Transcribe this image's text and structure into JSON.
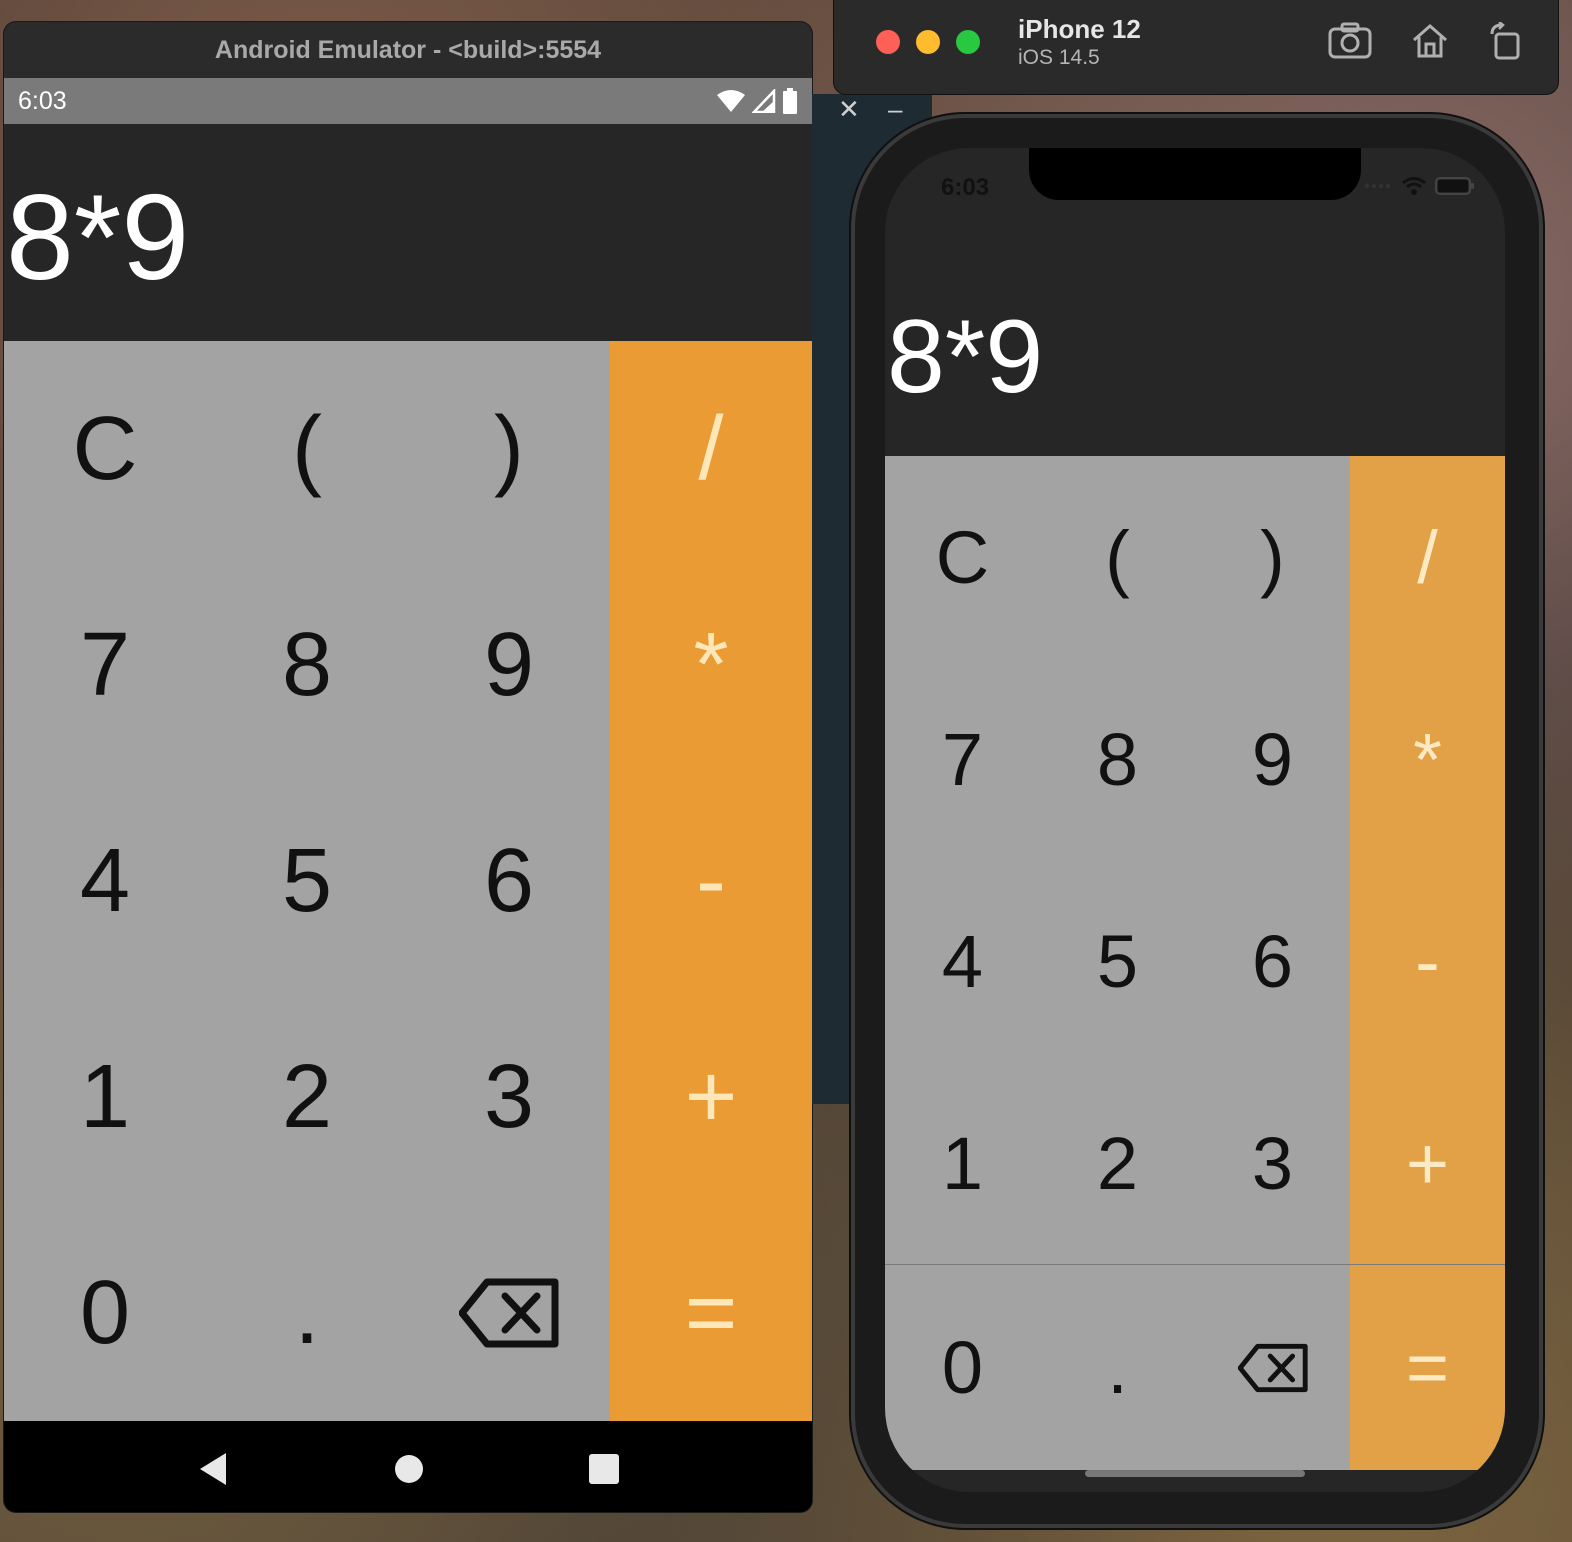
{
  "android": {
    "title": "Android Emulator - <build>:5554",
    "status_time": "6:03",
    "expression": "8*9",
    "keys": [
      {
        "label": "C",
        "op": false
      },
      {
        "label": "(",
        "op": false
      },
      {
        "label": ")",
        "op": false
      },
      {
        "label": "/",
        "op": true
      },
      {
        "label": "7",
        "op": false
      },
      {
        "label": "8",
        "op": false
      },
      {
        "label": "9",
        "op": false
      },
      {
        "label": "*",
        "op": true
      },
      {
        "label": "4",
        "op": false
      },
      {
        "label": "5",
        "op": false
      },
      {
        "label": "6",
        "op": false
      },
      {
        "label": "-",
        "op": true
      },
      {
        "label": "1",
        "op": false
      },
      {
        "label": "2",
        "op": false
      },
      {
        "label": "3",
        "op": false
      },
      {
        "label": "+",
        "op": true
      },
      {
        "label": "0",
        "op": false
      },
      {
        "label": ".",
        "op": false
      },
      {
        "label": "backspace",
        "op": false
      },
      {
        "label": "=",
        "op": true
      }
    ]
  },
  "ios": {
    "device_name": "iPhone 12",
    "os_version": "iOS 14.5",
    "status_time": "6:03",
    "expression": "8*9",
    "keys": [
      {
        "label": "C",
        "op": false
      },
      {
        "label": "(",
        "op": false
      },
      {
        "label": ")",
        "op": false
      },
      {
        "label": "/",
        "op": true
      },
      {
        "label": "7",
        "op": false
      },
      {
        "label": "8",
        "op": false
      },
      {
        "label": "9",
        "op": false
      },
      {
        "label": "*",
        "op": true
      },
      {
        "label": "4",
        "op": false
      },
      {
        "label": "5",
        "op": false
      },
      {
        "label": "6",
        "op": false
      },
      {
        "label": "-",
        "op": true
      },
      {
        "label": "1",
        "op": false
      },
      {
        "label": "2",
        "op": false
      },
      {
        "label": "3",
        "op": false
      },
      {
        "label": "+",
        "op": true
      },
      {
        "label": "0",
        "op": false
      },
      {
        "label": ".",
        "op": false
      },
      {
        "label": "backspace",
        "op": false
      },
      {
        "label": "=",
        "op": true
      }
    ]
  },
  "colors": {
    "operator_android": "#ea9b34",
    "operator_ios": "#e2a047",
    "keypad_gray": "#a3a3a3",
    "display_bg": "#262626"
  }
}
